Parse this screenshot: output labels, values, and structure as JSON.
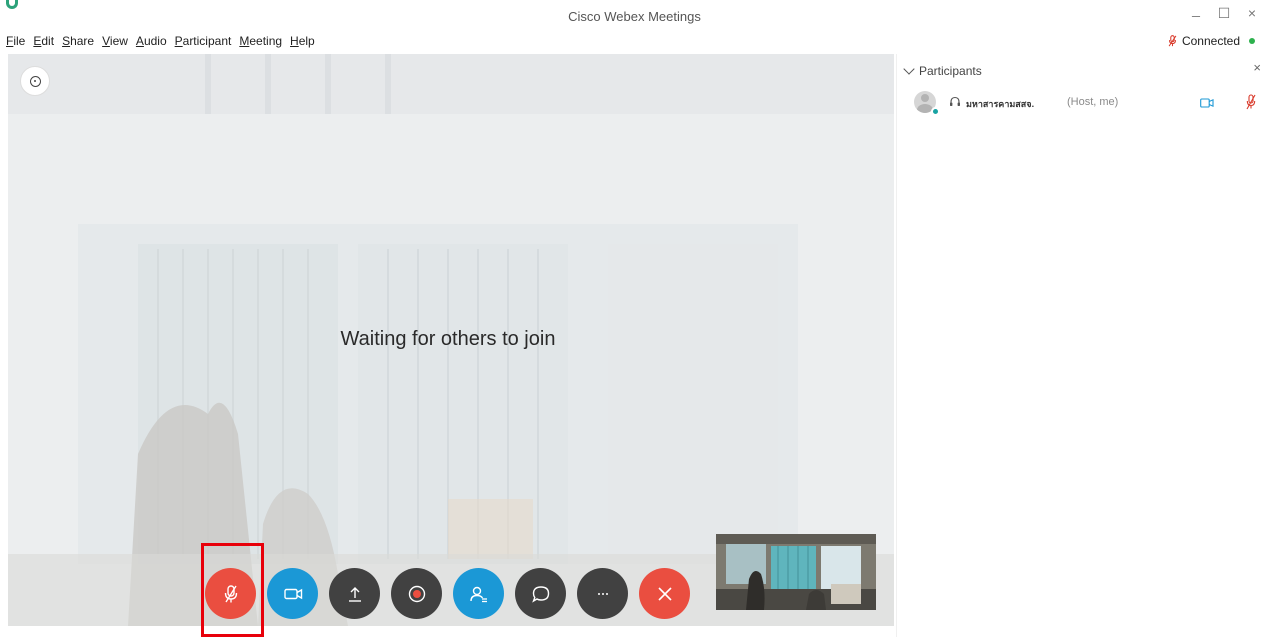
{
  "window": {
    "title": "Cisco Webex Meetings",
    "minimize_glyph": "_",
    "maximize_glyph": "☐",
    "close_glyph": "×"
  },
  "menu": {
    "items": [
      {
        "key": "F",
        "rest": "ile"
      },
      {
        "key": "E",
        "rest": "dit"
      },
      {
        "key": "S",
        "rest": "hare"
      },
      {
        "key": "V",
        "rest": "iew"
      },
      {
        "key": "A",
        "rest": "udio"
      },
      {
        "key": "P",
        "rest": "articipant"
      },
      {
        "key": "M",
        "rest": "eeting"
      },
      {
        "key": "H",
        "rest": "elp"
      }
    ]
  },
  "connection": {
    "status": "Connected",
    "dot_color": "#2db14d",
    "icon": "muted-mic-icon"
  },
  "stage": {
    "message": "Waiting for others to join",
    "info_icon": "info-icon"
  },
  "controls": [
    {
      "name": "mute-button",
      "icon": "muted-mic-icon",
      "color": "#ea4e40"
    },
    {
      "name": "video-button",
      "icon": "video-camera-icon",
      "color": "#1b98d6"
    },
    {
      "name": "share-button",
      "icon": "upload-arrow-icon",
      "color": "#414141"
    },
    {
      "name": "record-button",
      "icon": "record-icon",
      "color": "#414141"
    },
    {
      "name": "participants-button",
      "icon": "participants-icon",
      "color": "#1b98d6"
    },
    {
      "name": "chat-button",
      "icon": "chat-bubble-icon",
      "color": "#414141"
    },
    {
      "name": "more-options-button",
      "icon": "ellipsis-icon",
      "color": "#414141"
    },
    {
      "name": "leave-meeting-button",
      "icon": "close-x-icon",
      "color": "#ea4e40"
    }
  ],
  "participants_panel": {
    "title": "Participants",
    "close_glyph": "×",
    "participants": [
      {
        "name": "มหาสารคามสสจ.",
        "role": "(Host, me)",
        "audio_icon": "headset-icon",
        "video_icon": "video-camera-icon",
        "mic_icon": "muted-mic-icon",
        "muted": true
      }
    ]
  },
  "colors": {
    "accent_red": "#ea4e40",
    "accent_blue": "#1b98d6",
    "highlight_box": "#e8000a",
    "presence": "#18a3a3"
  }
}
